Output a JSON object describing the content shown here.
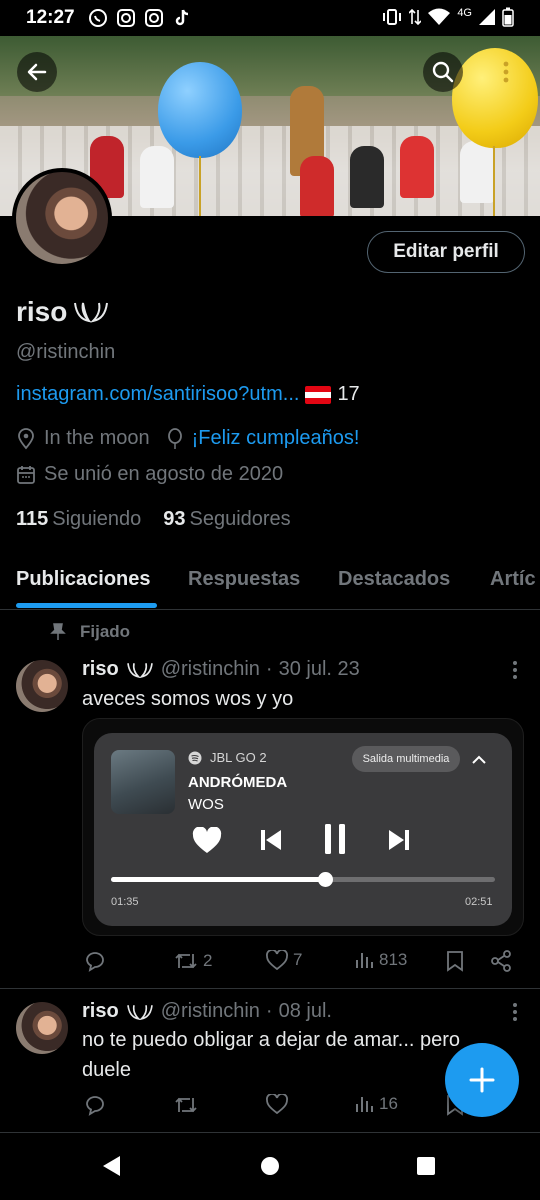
{
  "status_bar": {
    "time": "12:27",
    "network": "4G"
  },
  "profile": {
    "name": "riso",
    "handle": "@ristinchin",
    "edit_label": "Editar perfil",
    "link": "instagram.com/santirisoo?utm...",
    "link_suffix": "17",
    "location": "In the moon",
    "birthday": "¡Feliz cumpleaños!",
    "joined": "Se unió en agosto de 2020",
    "following_count": "115",
    "following_label": "Siguiendo",
    "followers_count": "93",
    "followers_label": "Seguidores"
  },
  "tabs": [
    {
      "label": "Publicaciones",
      "active": true
    },
    {
      "label": "Respuestas",
      "active": false
    },
    {
      "label": "Destacados",
      "active": false
    },
    {
      "label": "Artíc",
      "active": false
    }
  ],
  "pinned_label": "Fijado",
  "posts": [
    {
      "name": "riso",
      "handle": "@ristinchin",
      "dot": "·",
      "date": "30 jul. 23",
      "text": "aveces somos wos y yo",
      "reposts": "2",
      "likes": "7",
      "views": "813"
    },
    {
      "name": "riso",
      "handle": "@ristinchin",
      "dot": "·",
      "date": "08 jul.",
      "text": "no te puedo obligar a dejar de amar... pero duele",
      "reposts": "",
      "likes": "",
      "views": "16"
    }
  ],
  "media_player": {
    "device": "JBL GO 2",
    "output_label": "Salida multimedia",
    "track": "ANDRÓMEDA",
    "artist": "WOS",
    "elapsed": "01:35",
    "duration": "02:51",
    "progress": 0.557
  },
  "colors": {
    "accent": "#1d9bf0",
    "background": "#000000",
    "muted_text": "#71767b",
    "player_bg": "#3a3a3c"
  },
  "icons": [
    "back-arrow-icon",
    "search-icon",
    "more-vert-icon",
    "link-icon",
    "location-icon",
    "balloon-icon",
    "calendar-icon",
    "pin-icon",
    "reply-icon",
    "repost-icon",
    "like-icon",
    "views-icon",
    "bookmark-icon",
    "share-icon",
    "heart-icon",
    "skip-previous-icon",
    "pause-icon",
    "skip-next-icon",
    "chevron-up-icon",
    "plus-icon"
  ]
}
